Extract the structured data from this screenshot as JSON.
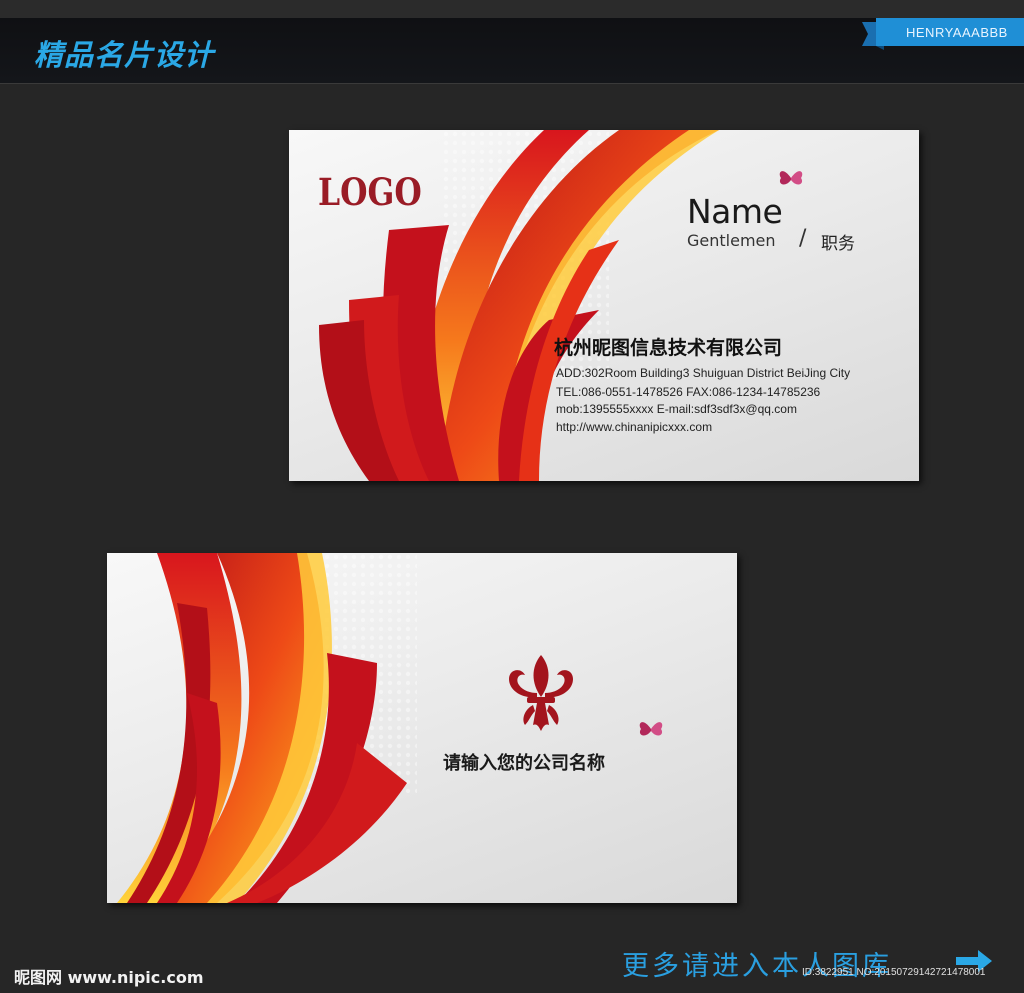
{
  "header": {
    "title": "精品名片设计",
    "author_badge": "HENRYAAABBB"
  },
  "front_card": {
    "logo": "LOGO",
    "name": "Name",
    "gentlemen": "Gentlemen",
    "slash": "/",
    "job_title": "职务",
    "company": "杭州昵图信息技术有限公司",
    "address": "ADD:302Room Building3 Shuiguan  District BeiJing City",
    "tel_fax": "TEL:086-0551-1478526   FAX:086-1234-14785236",
    "mobile_email": "mob:1395555xxxx  E-mail:sdf3sdf3x@qq.com",
    "website": "http://www.chinanipicxxx.com"
  },
  "back_card": {
    "company_prompt": "请输入您的公司名称"
  },
  "footer": {
    "site_logo": "昵图网 www.nipic.com",
    "more_link": "更多请进入本人图库",
    "image_id": "ID:3822951 NO:20150729142721478001"
  },
  "colors": {
    "background": "#262626",
    "header_bar": "#121317",
    "accent_blue": "#2aa8e6",
    "logo_red": "#9a1c26",
    "swoosh_red": "#c8101e",
    "swoosh_orange": "#f26a1b",
    "swoosh_yellow": "#ffc21a"
  },
  "icons": [
    "ribbon-banner-icon",
    "butterfly-icon",
    "fleur-de-lis-icon",
    "arrow-right-icon"
  ]
}
